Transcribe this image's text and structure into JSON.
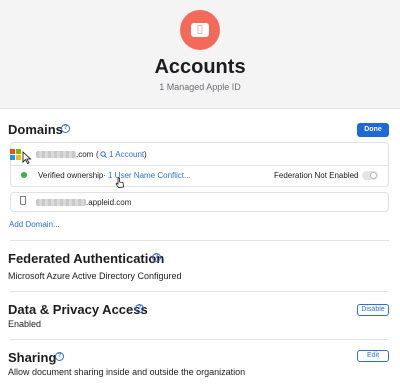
{
  "header": {
    "title": "Accounts",
    "subtitle": "1 Managed Apple ID",
    "icon": "apple-id-card-icon"
  },
  "domains": {
    "title": "Domains",
    "done_label": "Done",
    "domain1": {
      "suffix": ".com",
      "accounts_link": "1 Account",
      "accounts_open": "(",
      "accounts_close": ")",
      "verified": "Verified ownership",
      "separator": "·",
      "conflict_link": "1 User Name Conflict...",
      "federation_status": "Federation Not Enabled"
    },
    "domain2": {
      "suffix": ".appleid.com"
    },
    "add_domain": "Add Domain..."
  },
  "federated_auth": {
    "title": "Federated Authentication",
    "value": "Microsoft Azure Active Directory Configured"
  },
  "privacy": {
    "title": "Data & Privacy Access",
    "value": "Enabled",
    "button": "Disable"
  },
  "sharing": {
    "title": "Sharing",
    "value": "Allow document sharing inside and outside the organization",
    "button": "Edit"
  },
  "colors": {
    "accent": "#2f6fd6",
    "app_icon": "#f46a5a",
    "verified_dot": "#35b24a"
  }
}
